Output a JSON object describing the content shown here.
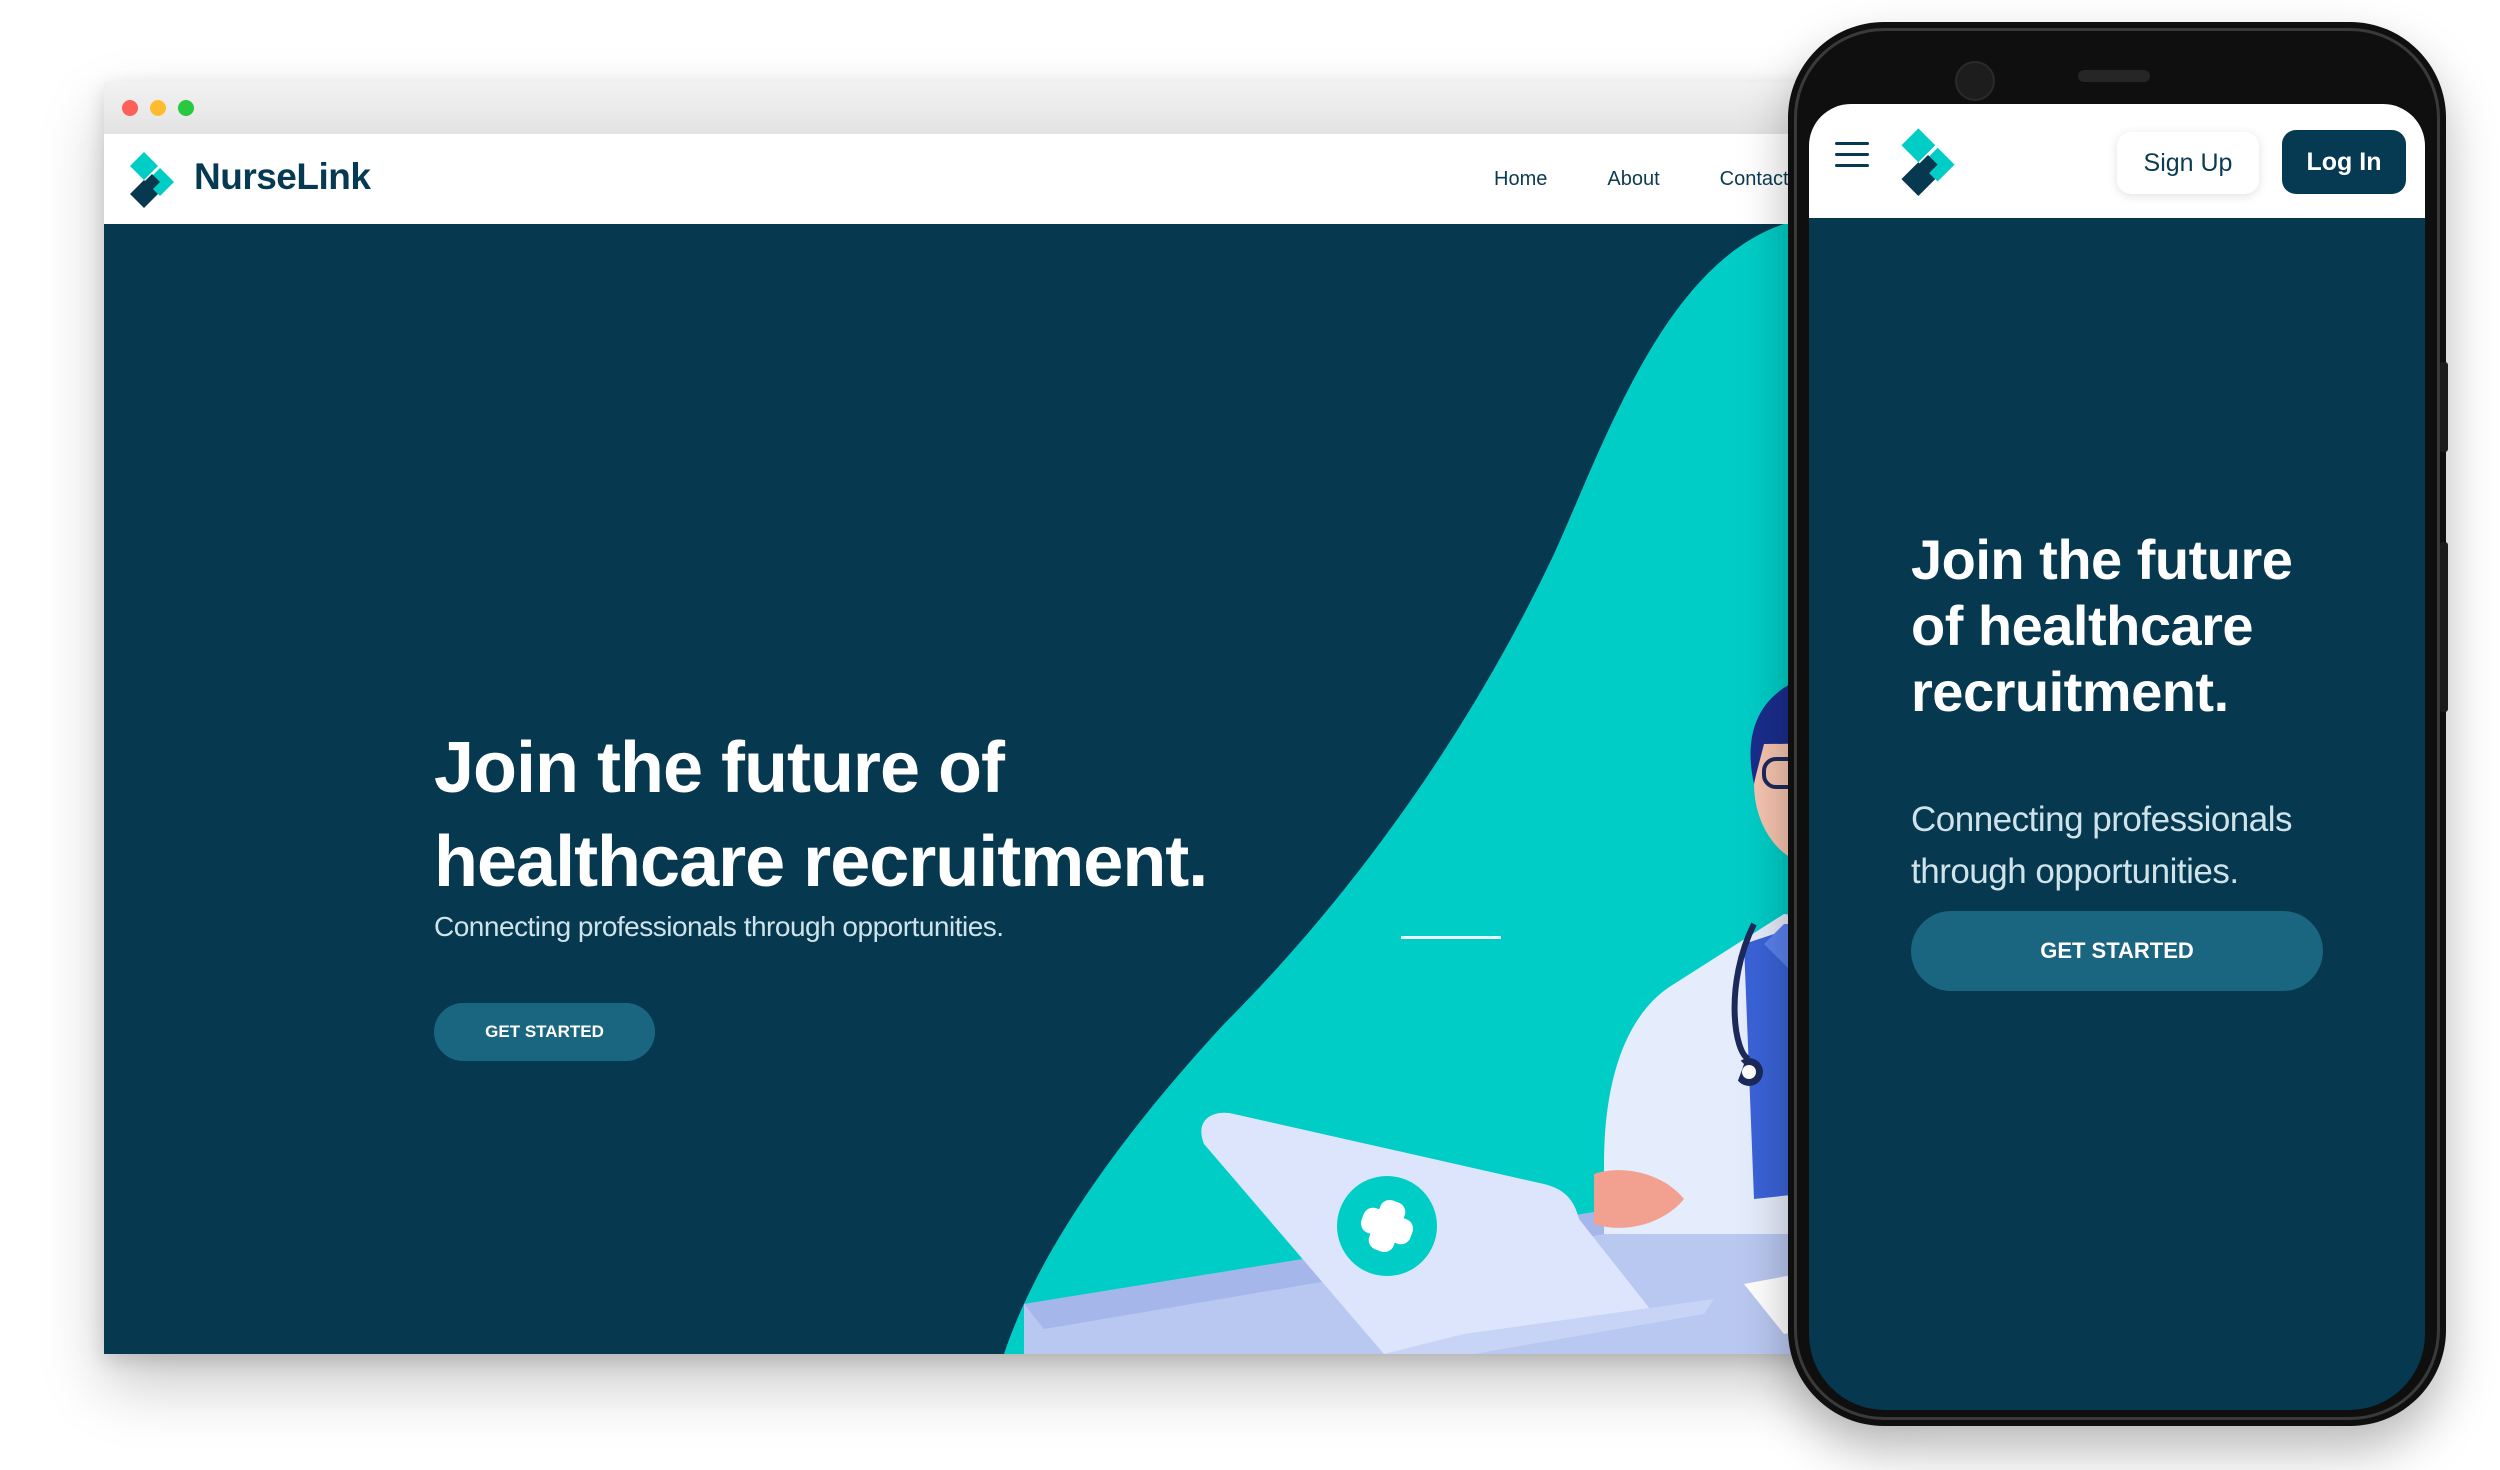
{
  "colors": {
    "navy": "#06384f",
    "teal": "#00cdc6",
    "button": "#1a6680",
    "white": "#ffffff"
  },
  "desktop": {
    "brand": "NurseLink",
    "nav": [
      "Home",
      "About",
      "Contact"
    ],
    "hero": {
      "title_line1": "Join the future of",
      "title_line2": "healthcare recruitment.",
      "subtitle": "Connecting professionals through opportunities.",
      "cta": "GET STARTED"
    }
  },
  "mobile": {
    "signup": "Sign Up",
    "login": "Log In",
    "hero": {
      "title": "Join the future of healthcare recruitment.",
      "subtitle": "Connecting professionals through opportunities.",
      "cta": "GET STARTED"
    },
    "menu_icon": "hamburger-icon"
  }
}
